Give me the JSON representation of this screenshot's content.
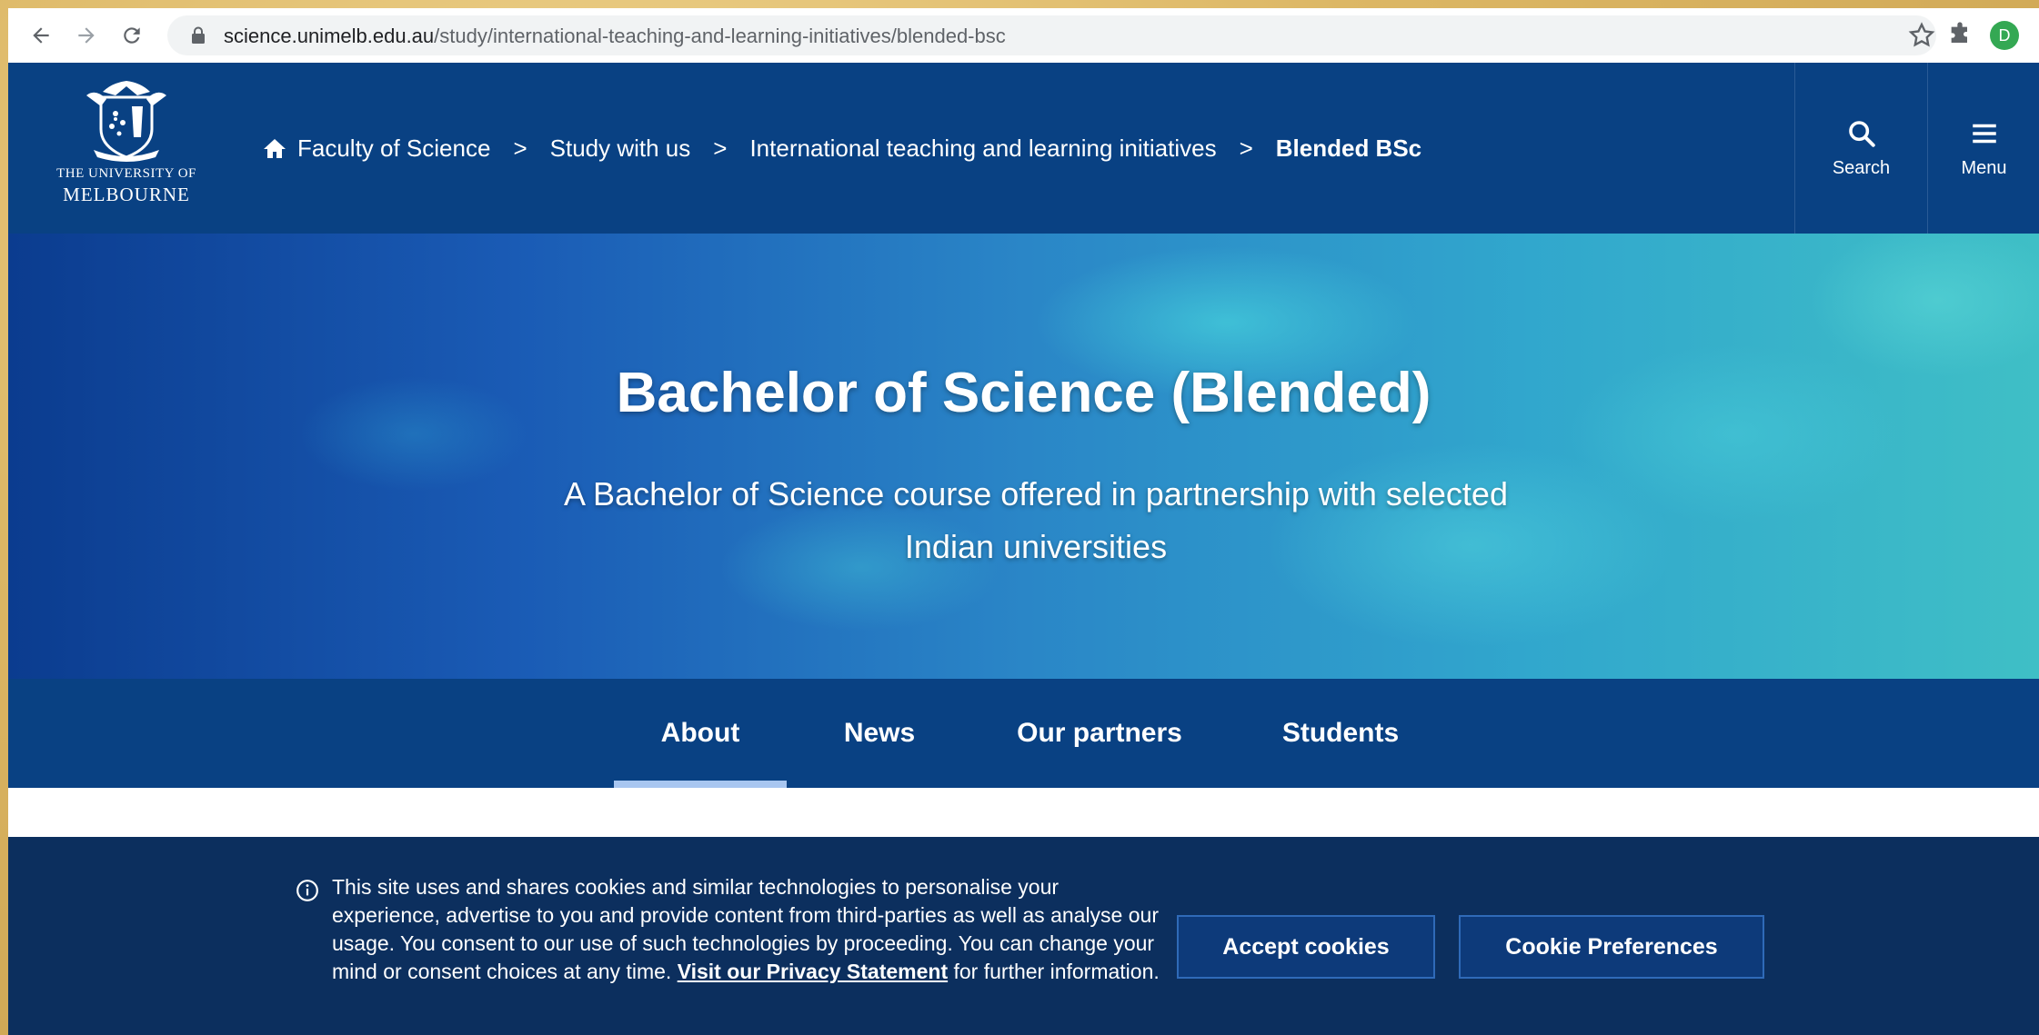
{
  "browser": {
    "url_host": "science.unimelb.edu.au",
    "url_path": "/study/international-teaching-and-learning-initiatives/blended-bsc",
    "profile_initial": "D"
  },
  "header": {
    "logo_line1": "THE UNIVERSITY OF",
    "logo_line2": "MELBOURNE",
    "breadcrumb": [
      "Faculty of Science",
      "Study with us",
      "International teaching and learning initiatives",
      "Blended BSc"
    ],
    "breadcrumb_separator": ">",
    "search_label": "Search",
    "menu_label": "Menu"
  },
  "hero": {
    "title": "Bachelor of Science (Blended)",
    "subtitle": "A Bachelor of Science course offered in partnership with selected Indian universities"
  },
  "tabs": [
    "About",
    "News",
    "Our partners",
    "Students"
  ],
  "active_tab": "About",
  "cookie": {
    "text_before_link": "This site uses and shares cookies and similar technologies to personalise your experience, advertise to you and provide content from third-parties as well as analyse our usage. You consent to our use of such technologies by proceeding. You can change your mind or consent choices at any time. ",
    "link_text": "Visit our Privacy Statement",
    "text_after_link": " for further information.",
    "accept_label": "Accept cookies",
    "preferences_label": "Cookie Preferences"
  },
  "colors": {
    "header_bg": "#094183",
    "cookie_bg": "#0c2f5e",
    "tab_underline": "#a8c6f0",
    "profile": "#34a853"
  }
}
